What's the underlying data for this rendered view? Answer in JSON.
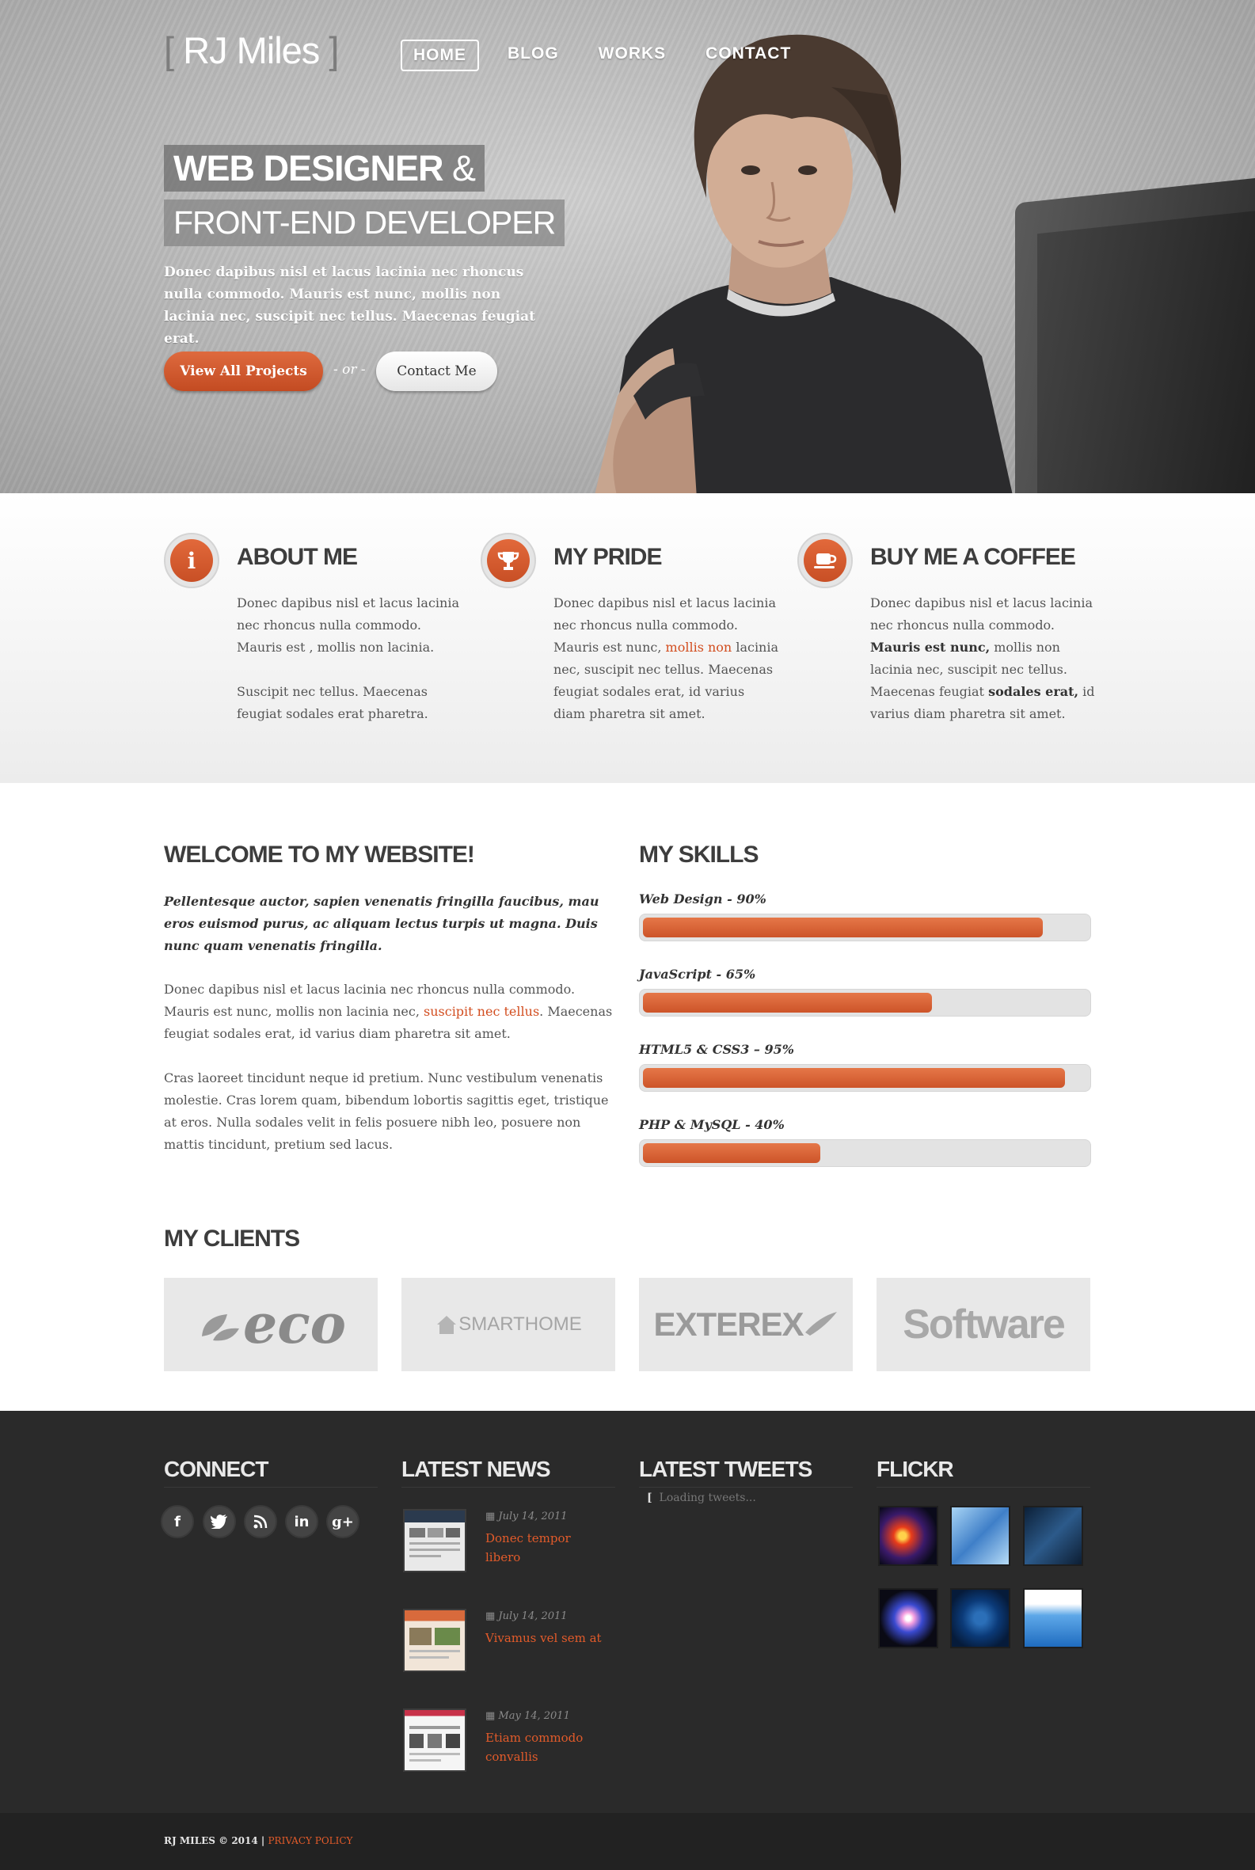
{
  "header": {
    "logo": "RJ Miles",
    "nav": [
      "HOME",
      "BLOG",
      "WORKS",
      "CONTACT"
    ],
    "active_nav": "HOME"
  },
  "hero": {
    "title_bold": "WEB DESIGNER",
    "title_amp": "&",
    "subtitle": "FRONT-END DEVELOPER",
    "description": "Donec dapibus nisl et lacus lacinia nec rhoncus nulla commodo. Mauris est nunc, mollis non lacinia nec, suscipit nec tellus. Maecenas feugiat erat.",
    "primary_button": "View All Projects",
    "or_text": "- or -",
    "secondary_button": "Contact Me"
  },
  "features": [
    {
      "icon": "info-icon",
      "title": "ABOUT ME",
      "p1": "Donec dapibus nisl et lacus lacinia nec rhoncus nulla commodo. Mauris est , mollis non lacinia.",
      "p2": "Suscipit nec tellus. Maecenas feugiat sodales erat pharetra."
    },
    {
      "icon": "trophy-icon",
      "title": "MY PRIDE",
      "text_before": "Donec dapibus nisl et lacus lacinia nec rhoncus nulla commodo. Mauris est nunc, ",
      "link": "mollis non",
      "text_after": " lacinia nec, suscipit nec tellus. Maecenas feugiat sodales erat, id varius diam pharetra sit amet."
    },
    {
      "icon": "coffee-cup-icon",
      "title": "BUY ME A COFFEE",
      "t1": "Donec dapibus nisl et lacus lacinia nec rhoncus nulla commodo. ",
      "b1": "Mauris est nunc,",
      "t2": " mollis non lacinia nec, suscipit nec tellus. Maecenas feugiat ",
      "b2": "sodales erat,",
      "t3": " id varius diam pharetra sit amet."
    }
  ],
  "welcome": {
    "title": "WELCOME TO MY WEBSITE!",
    "lead": "Pellentesque auctor, sapien venenatis fringilla faucibus, mau eros euismod purus, ac aliquam lectus turpis ut magna. Duis nunc quam venenatis fringilla.",
    "p1_before": "Donec dapibus nisl et lacus lacinia nec rhoncus nulla commodo. Mauris est nunc, mollis non lacinia nec, ",
    "p1_link": "suscipit nec tellus",
    "p1_after": ". Maecenas feugiat sodales erat, id varius diam pharetra sit amet.",
    "p2": "Cras laoreet tincidunt neque id pretium. Nunc vestibulum venenatis molestie. Cras lorem quam, bibendum lobortis sagittis eget, tristique at eros. Nulla sodales velit in felis posuere nibh leo, posuere non mattis tincidunt, pretium sed lacus."
  },
  "skills": {
    "title": "MY SKILLS",
    "items": [
      {
        "label": "Web Design - 90%",
        "percent": 90
      },
      {
        "label": "JavaScript - 65%",
        "percent": 65
      },
      {
        "label": "HTML5 & CSS3 – 95%",
        "percent": 95
      },
      {
        "label": "PHP & MySQL - 40%",
        "percent": 40
      }
    ]
  },
  "clients": {
    "title": "MY CLIENTS",
    "logos": [
      "eco",
      "SMARTHOME",
      "EXTEREX",
      "Software"
    ]
  },
  "footer": {
    "connect_title": "CONNECT",
    "social_icons": [
      "facebook-icon",
      "twitter-icon",
      "rss-icon",
      "linkedin-icon",
      "google-plus-icon"
    ],
    "news_title": "LATEST NEWS",
    "news": [
      {
        "date": "July 14, 2011",
        "title": "Donec tempor libero"
      },
      {
        "date": "July 14, 2011",
        "title": "Vivamus vel sem at"
      },
      {
        "date": "May 14, 2011",
        "title": "Etiam commodo convallis"
      }
    ],
    "tweets_title": "LATEST TWEETS",
    "tweets_loading": "Loading tweets...",
    "flickr_title": "FLICKR",
    "copyright": "RJ MILES © 2014 |",
    "privacy": "PRIVACY POLICY"
  }
}
